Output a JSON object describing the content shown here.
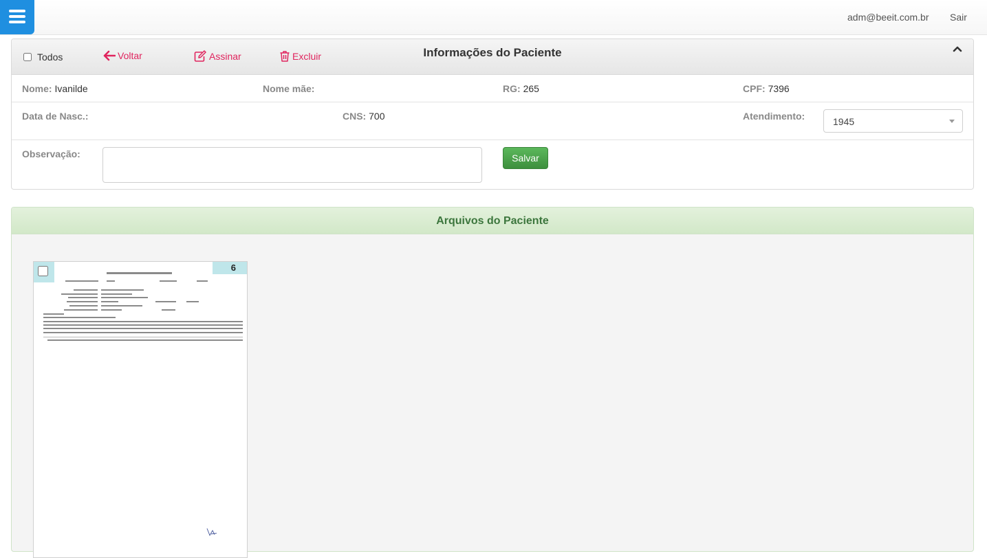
{
  "topbar": {
    "user_email": "adm@beeit.com.br",
    "logout_label": "Sair"
  },
  "patient_panel": {
    "select_all_label": "Todos",
    "actions": {
      "back_label": "Voltar",
      "sign_label": "Assinar",
      "delete_label": "Excluir"
    },
    "title": "Informações do Paciente",
    "fields": {
      "nome_label": "Nome:",
      "nome_value": "Ivanilde",
      "nome_mae_label": "Nome mãe:",
      "nome_mae_value": "",
      "rg_label": "RG:",
      "rg_value": "265",
      "cpf_label": "CPF:",
      "cpf_value": "7396",
      "data_nasc_label": "Data de Nasc.:",
      "data_nasc_value": "",
      "cns_label": "CNS:",
      "cns_value": "700",
      "atendimento_label": "Atendimento:",
      "atendimento_selected": "1945",
      "observacao_label": "Observação:",
      "observacao_value": ""
    },
    "save_label": "Salvar"
  },
  "files_panel": {
    "title": "Arquivos do Paciente",
    "files": [
      {
        "badge": "6"
      }
    ]
  },
  "colors": {
    "menu_button": "#1f8fe0",
    "action_link": "#e0245e",
    "save_button": "#4cae4c",
    "files_title": "#3c763d",
    "thumb_badge": "#bfe6ea"
  },
  "icons": {
    "menu": "hamburger-menu-icon",
    "back": "arrow-left-icon",
    "sign": "edit-icon",
    "delete": "trash-icon",
    "collapse": "chevron-up-icon"
  }
}
